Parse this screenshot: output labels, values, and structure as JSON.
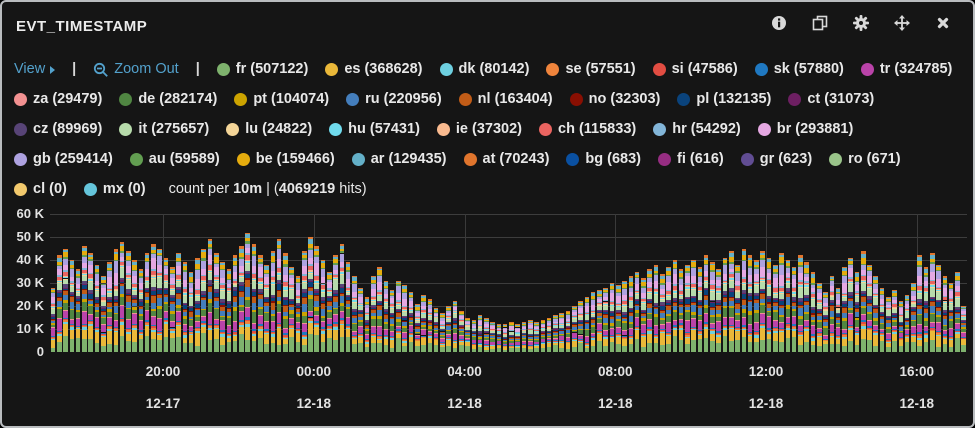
{
  "panel": {
    "title": "EVT_TIMESTAMP"
  },
  "toolbar": {
    "icons": [
      "info",
      "duplicate",
      "settings",
      "move",
      "close"
    ]
  },
  "legend": {
    "view_label": "View",
    "zoom_out_label": "Zoom Out",
    "summary": {
      "count_per_label": "count per",
      "interval": "10m",
      "separator": "| (",
      "hits_value": "4069219",
      "hits_label": "hits)"
    }
  },
  "chart_data": {
    "type": "bar",
    "stacked": true,
    "unit": "count per 10m",
    "total_hits": 4069219,
    "ylim": [
      0,
      60000
    ],
    "grid": true,
    "legend_position": "top",
    "y_ticks": [
      {
        "label": "0",
        "value": 0
      },
      {
        "label": "10 K",
        "value": 10
      },
      {
        "label": "20 K",
        "value": 20
      },
      {
        "label": "30 K",
        "value": 30
      },
      {
        "label": "40 K",
        "value": 40
      },
      {
        "label": "50 K",
        "value": 50
      },
      {
        "label": "60 K",
        "value": 60
      }
    ],
    "x_ticks": [
      {
        "time": "20:00",
        "date": "12-17",
        "index": 18
      },
      {
        "time": "00:00",
        "date": "12-18",
        "index": 42
      },
      {
        "time": "04:00",
        "date": "12-18",
        "index": 66
      },
      {
        "time": "08:00",
        "date": "12-18",
        "index": 90
      },
      {
        "time": "12:00",
        "date": "12-18",
        "index": 114
      },
      {
        "time": "16:00",
        "date": "12-18",
        "index": 138
      }
    ],
    "totals_10m_thousands": [
      28,
      42,
      45,
      40,
      36,
      46,
      43,
      38,
      33,
      39,
      45,
      48,
      44,
      40,
      36,
      43,
      47,
      45,
      41,
      37,
      43,
      39,
      35,
      41,
      45,
      49,
      43,
      39,
      36,
      42,
      46,
      52,
      47,
      42,
      38,
      44,
      49,
      43,
      37,
      33,
      44,
      50,
      46,
      40,
      35,
      42,
      47,
      39,
      33,
      28,
      24,
      33,
      37,
      31,
      27,
      31,
      29,
      26,
      21,
      25,
      23,
      19,
      17,
      20,
      22,
      18,
      15,
      14,
      16,
      15,
      13,
      12,
      12,
      13,
      12,
      13,
      14,
      13,
      14,
      15,
      16,
      17,
      18,
      20,
      22,
      24,
      26,
      27,
      28,
      30,
      29,
      31,
      33,
      35,
      32,
      36,
      38,
      34,
      37,
      40,
      36,
      38,
      40,
      37,
      42,
      39,
      36,
      41,
      44,
      38,
      45,
      42,
      40,
      44,
      41,
      38,
      43,
      40,
      37,
      42,
      39,
      35,
      30,
      26,
      33,
      28,
      37,
      41,
      35,
      44,
      38,
      33,
      28,
      24,
      27,
      22,
      25,
      30,
      42,
      37,
      43,
      38,
      33,
      30,
      35,
      20
    ],
    "series": [
      {
        "name": "fr",
        "count": 507122,
        "color": "#7EB26D"
      },
      {
        "name": "es",
        "count": 368628,
        "color": "#EAB839"
      },
      {
        "name": "dk",
        "count": 80142,
        "color": "#6ED0E0"
      },
      {
        "name": "se",
        "count": 57551,
        "color": "#EF843C"
      },
      {
        "name": "si",
        "count": 47586,
        "color": "#E24D42"
      },
      {
        "name": "sk",
        "count": 57880,
        "color": "#1F78C1"
      },
      {
        "name": "tr",
        "count": 324785,
        "color": "#BA43A9"
      },
      {
        "name": "za",
        "count": 29479,
        "color": "#F29191"
      },
      {
        "name": "de",
        "count": 282174,
        "color": "#508642"
      },
      {
        "name": "pt",
        "count": 104074,
        "color": "#CCA300"
      },
      {
        "name": "ru",
        "count": 220956,
        "color": "#447EBC"
      },
      {
        "name": "nl",
        "count": 163404,
        "color": "#C15C17"
      },
      {
        "name": "no",
        "count": 32303,
        "color": "#890F02"
      },
      {
        "name": "pl",
        "count": 132135,
        "color": "#0A437C"
      },
      {
        "name": "ct",
        "count": 31073,
        "color": "#6D1F62"
      },
      {
        "name": "cz",
        "count": 89969,
        "color": "#584477"
      },
      {
        "name": "it",
        "count": 275657,
        "color": "#B7DBAB"
      },
      {
        "name": "lu",
        "count": 24822,
        "color": "#F4D598"
      },
      {
        "name": "hu",
        "count": 57431,
        "color": "#70DBED"
      },
      {
        "name": "ie",
        "count": 37302,
        "color": "#F9BA8F"
      },
      {
        "name": "ch",
        "count": 115833,
        "color": "#EA6460"
      },
      {
        "name": "hr",
        "count": 54292,
        "color": "#82B5D8"
      },
      {
        "name": "br",
        "count": 293881,
        "color": "#E5A8E2"
      },
      {
        "name": "gb",
        "count": 259414,
        "color": "#AEA2E0"
      },
      {
        "name": "au",
        "count": 59589,
        "color": "#629E51"
      },
      {
        "name": "be",
        "count": 159466,
        "color": "#E5AC0E"
      },
      {
        "name": "ar",
        "count": 129435,
        "color": "#64B0C8"
      },
      {
        "name": "at",
        "count": 70243,
        "color": "#E0752D"
      },
      {
        "name": "bg",
        "count": 683,
        "color": "#0A50A1"
      },
      {
        "name": "fi",
        "count": 616,
        "color": "#962D82"
      },
      {
        "name": "gr",
        "count": 623,
        "color": "#614D93"
      },
      {
        "name": "ro",
        "count": 671,
        "color": "#9AC48A"
      },
      {
        "name": "cl",
        "count": 0,
        "color": "#F2C96D"
      },
      {
        "name": "mx",
        "count": 0,
        "color": "#65C5DB"
      }
    ]
  }
}
